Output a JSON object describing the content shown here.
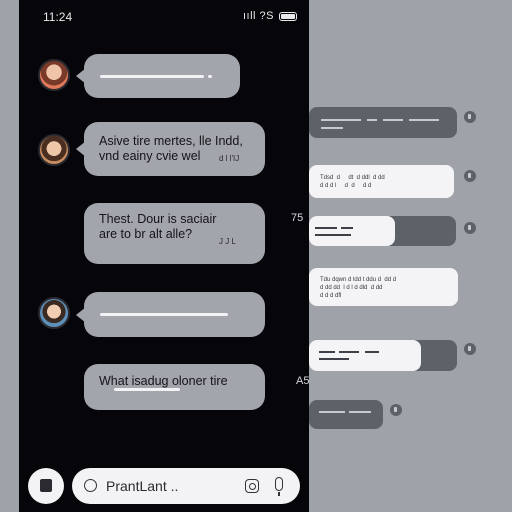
{
  "status_bar": {
    "time": "11:24",
    "network": "ııll ?S"
  },
  "messages": [
    {
      "text": ""
    },
    {
      "text": "Asive tire mertes, lle Indd,\nvnd eainy cvie wel",
      "meta": "d l l'IJ"
    },
    {
      "text": "Thest. Dour is saciair\nare to br alt alle?",
      "meta": "J J  L"
    },
    {
      "text": ""
    },
    {
      "text": "What isadug oloner tire"
    }
  ],
  "side_labels": {
    "left_mid": "75",
    "left_low": "A5"
  },
  "composer": {
    "placeholder": "PrantLant ..",
    "value": ""
  },
  "ghost_panel": {
    "block2_text": "Tdsd  d     dt  d ddl  d dd\nd d d l     d  d     d d",
    "block4_text": "Tdu dqwn d ldd t ddu d  dd d\nd dd dd  l d l d dld  d dd\nd d d dfl"
  }
}
